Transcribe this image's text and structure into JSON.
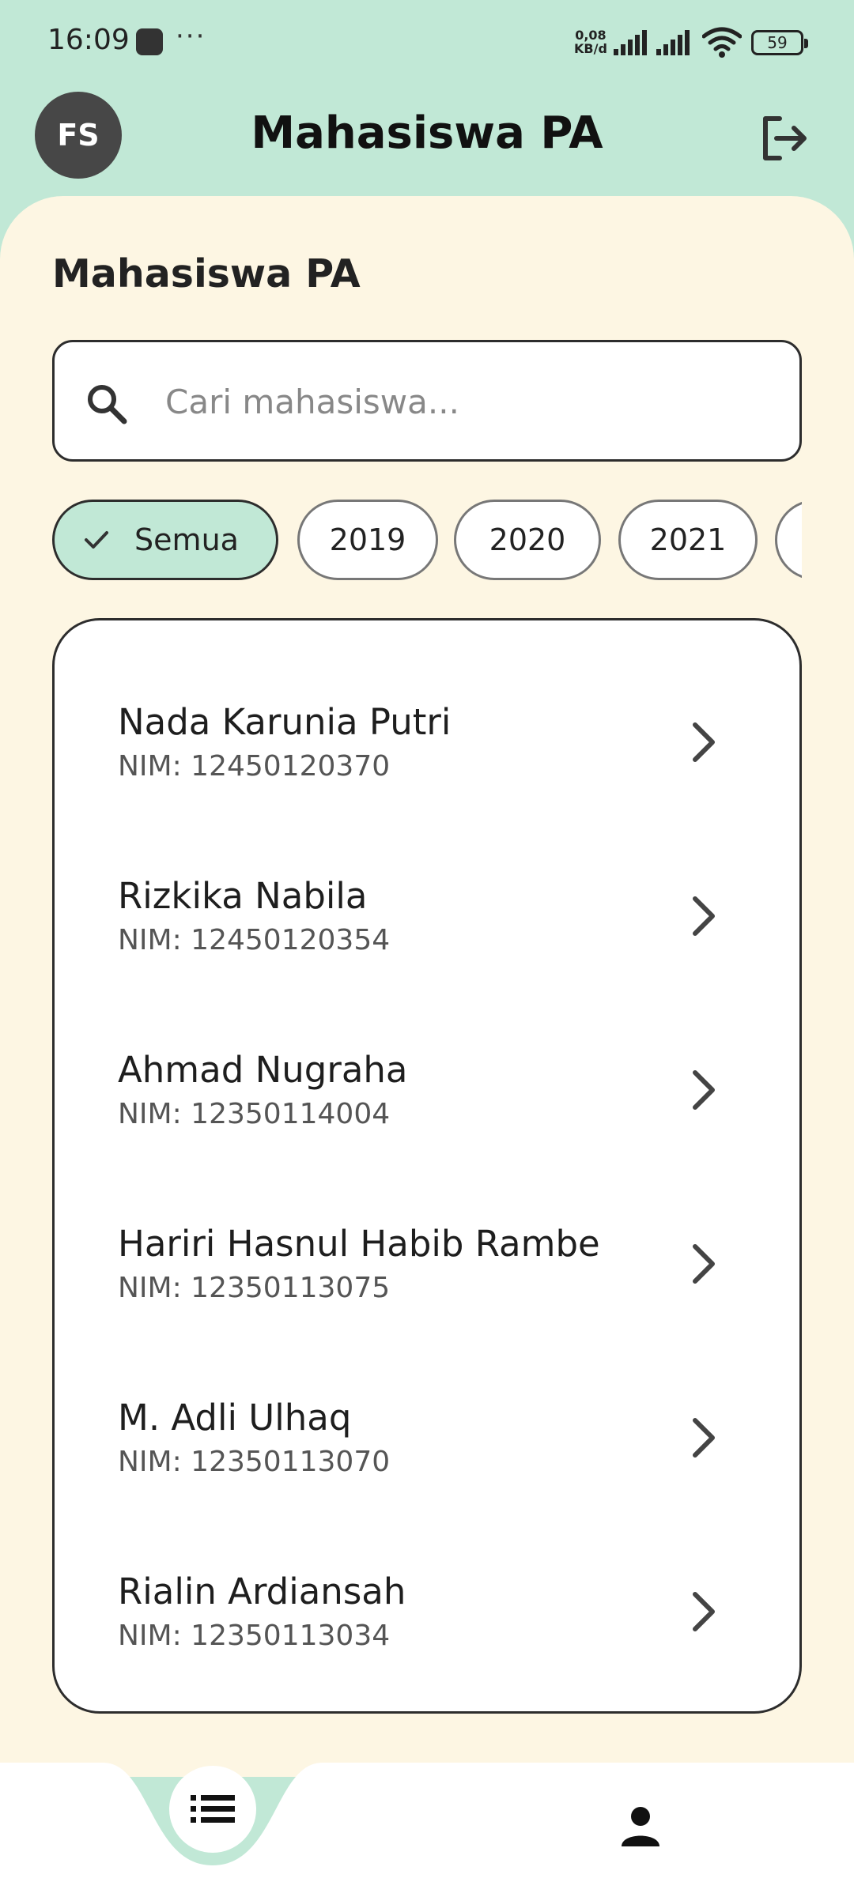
{
  "status_bar": {
    "time": "16:09",
    "speed_value": "0,08",
    "speed_unit": "KB/d",
    "battery": "59"
  },
  "app_bar": {
    "avatar_initials": "FS",
    "title": "Mahasiswa PA",
    "logout_icon": "logout-icon"
  },
  "main": {
    "section_title": "Mahasiswa PA",
    "search": {
      "placeholder": "Cari mahasiswa...",
      "value": ""
    },
    "filters": [
      {
        "label": "Semua",
        "selected": true
      },
      {
        "label": "2019",
        "selected": false
      },
      {
        "label": "2020",
        "selected": false
      },
      {
        "label": "2021",
        "selected": false
      },
      {
        "label": "",
        "selected": false
      }
    ],
    "students": [
      {
        "name": "Nada Karunia Putri",
        "nim": "NIM: 12450120370"
      },
      {
        "name": "Rizkika Nabila",
        "nim": "NIM: 12450120354"
      },
      {
        "name": "Ahmad Nugraha",
        "nim": "NIM: 12350114004"
      },
      {
        "name": "Hariri Hasnul Habib Rambe",
        "nim": "NIM: 12350113075"
      },
      {
        "name": "M. Adli Ulhaq",
        "nim": "NIM: 12350113070"
      },
      {
        "name": "Rialin Ardiansah",
        "nim": "NIM: 12350113034"
      }
    ]
  },
  "bottom_nav": {
    "items": [
      {
        "icon": "list-icon",
        "active": true
      },
      {
        "icon": "person-icon",
        "active": false
      }
    ]
  },
  "colors": {
    "header_bg": "#c1e8d6",
    "content_bg": "#fdf6e3",
    "selected_chip": "#c1e8d6",
    "avatar_bg": "#474747"
  }
}
